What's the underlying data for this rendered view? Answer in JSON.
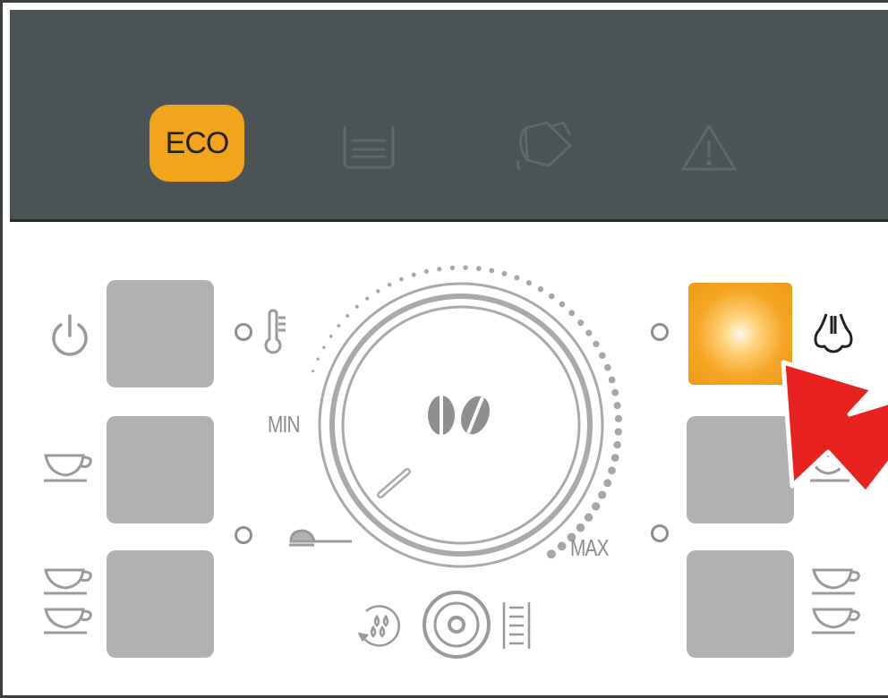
{
  "status_bar": {
    "eco_label": "ECO"
  },
  "dial": {
    "min_label": "MIN",
    "max_label": "MAX"
  },
  "colors": {
    "panel_dark": "#4b5354",
    "accent_orange": "#f2a51a",
    "button_gray": "#b1b1b1",
    "arrow_red": "#e8231f"
  },
  "icons": [
    "power-icon",
    "temperature-icon",
    "espresso-cup-icon",
    "double-cup-icon",
    "coffee-beans-icon",
    "spoon-icon",
    "descale-icon",
    "rinse-icon",
    "water-hardness-icon",
    "steam-icon",
    "hot-water-icon",
    "water-tank-icon",
    "grounds-container-icon",
    "warning-icon",
    "pointer-arrow-icon"
  ]
}
